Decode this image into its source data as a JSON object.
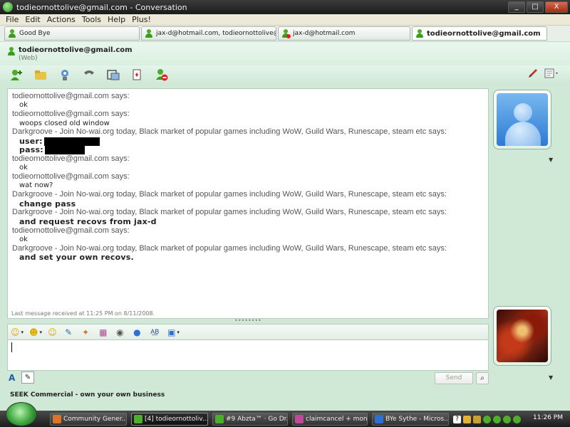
{
  "window": {
    "title": "todieornottolive@gmail.com - Conversation",
    "controls": [
      "_",
      "□",
      "X"
    ]
  },
  "menu": [
    "File",
    "Edit",
    "Actions",
    "Tools",
    "Help",
    "Plus!"
  ],
  "tabs": [
    {
      "label": "Good Bye",
      "status": "online"
    },
    {
      "label": "jax-d@hotmail.com, todieornottolive@gn...",
      "status": "online"
    },
    {
      "label": "jax-d@hotmail.com",
      "status": "busy"
    },
    {
      "label": "todieornottolive@gmail.com",
      "status": "online",
      "active": true
    }
  ],
  "contact": {
    "name": "todieornottolive@gmail.com",
    "sub": "(Web)"
  },
  "toolbar": {
    "icons": [
      "invite-contact-icon",
      "send-files-icon",
      "video-call-icon",
      "call-icon",
      "activities-icon",
      "games-icon",
      "block-icon"
    ],
    "right_icons": [
      "pen-icon",
      "menu-dropdown-icon"
    ]
  },
  "messages": [
    {
      "sender": "todieornottolive@gmail.com says:",
      "text": "ok",
      "bold": false
    },
    {
      "sender": "todieornottolive@gmail.com says:",
      "text": "woops closed old window",
      "bold": false
    },
    {
      "sender": "Darkgroove - Join No-wai.org today, Black market of popular games including WoW, Guild Wars, Runescape, steam etc says:",
      "text": "user:",
      "bold": true,
      "redacted": true,
      "extra": "pass:"
    },
    {
      "sender": "todieornottolive@gmail.com says:",
      "text": "ok",
      "bold": false
    },
    {
      "sender": "todieornottolive@gmail.com says:",
      "text": "wat now?",
      "bold": false
    },
    {
      "sender": "Darkgroove - Join No-wai.org today, Black market of popular games including WoW, Guild Wars, Runescape, steam etc says:",
      "text": "change pass",
      "bold": true
    },
    {
      "sender": "Darkgroove - Join No-wai.org today, Black market of popular games including WoW, Guild Wars, Runescape, steam etc says:",
      "text": "and request recovs from jax-d",
      "bold": true
    },
    {
      "sender": "todieornottolive@gmail.com says:",
      "text": "ok",
      "bold": false
    },
    {
      "sender": "Darkgroove - Join No-wai.org today, Black market of popular games including WoW, Guild Wars, Runescape, steam etc says:",
      "text": "and set your own recovs.",
      "bold": true
    }
  ],
  "last_message": "Last message received at 11:25 PM on 8/11/2008.",
  "divider": "••••••••",
  "format_bar": {
    "icons": [
      "emoticon-icon",
      "wink-icon",
      "nudge-icon",
      "voice-clip-icon",
      "ink-icon",
      "background-icon",
      "winks-icon",
      "handwriting-icon",
      "spellcheck-icon",
      "font-color-icon"
    ]
  },
  "input": {
    "value": ""
  },
  "bottom": {
    "font_label": "A",
    "send_label": "Send"
  },
  "ad_text": "SEEK Commercial - own your own business",
  "taskbar": {
    "items": [
      {
        "label": "Community Gener...",
        "color": "#d8752a"
      },
      {
        "label": "[4] todieornottoliv...",
        "color": "#4cae2a",
        "active": true
      },
      {
        "label": "#9 Abzta™ · Go Dr...",
        "color": "#4cae2a"
      },
      {
        "label": "claimcancel + mon...",
        "color": "#c04a9a"
      },
      {
        "label": "BYe Sythe - Micros...",
        "color": "#2e6fd0"
      }
    ],
    "clock": "11:26 PM",
    "tray_colors": [
      "#ffffff",
      "#e3b13a",
      "#c8a030",
      "#4cae2a",
      "#4cae2a",
      "#4cae2a",
      "#4cae2a",
      "#4cae2a",
      "#4cae2a"
    ]
  },
  "colors": {
    "accent": "#4cae2a",
    "window_bg": "#cfe9d6",
    "titlebar": "#1b1b1b",
    "sender_text": "#555555"
  }
}
